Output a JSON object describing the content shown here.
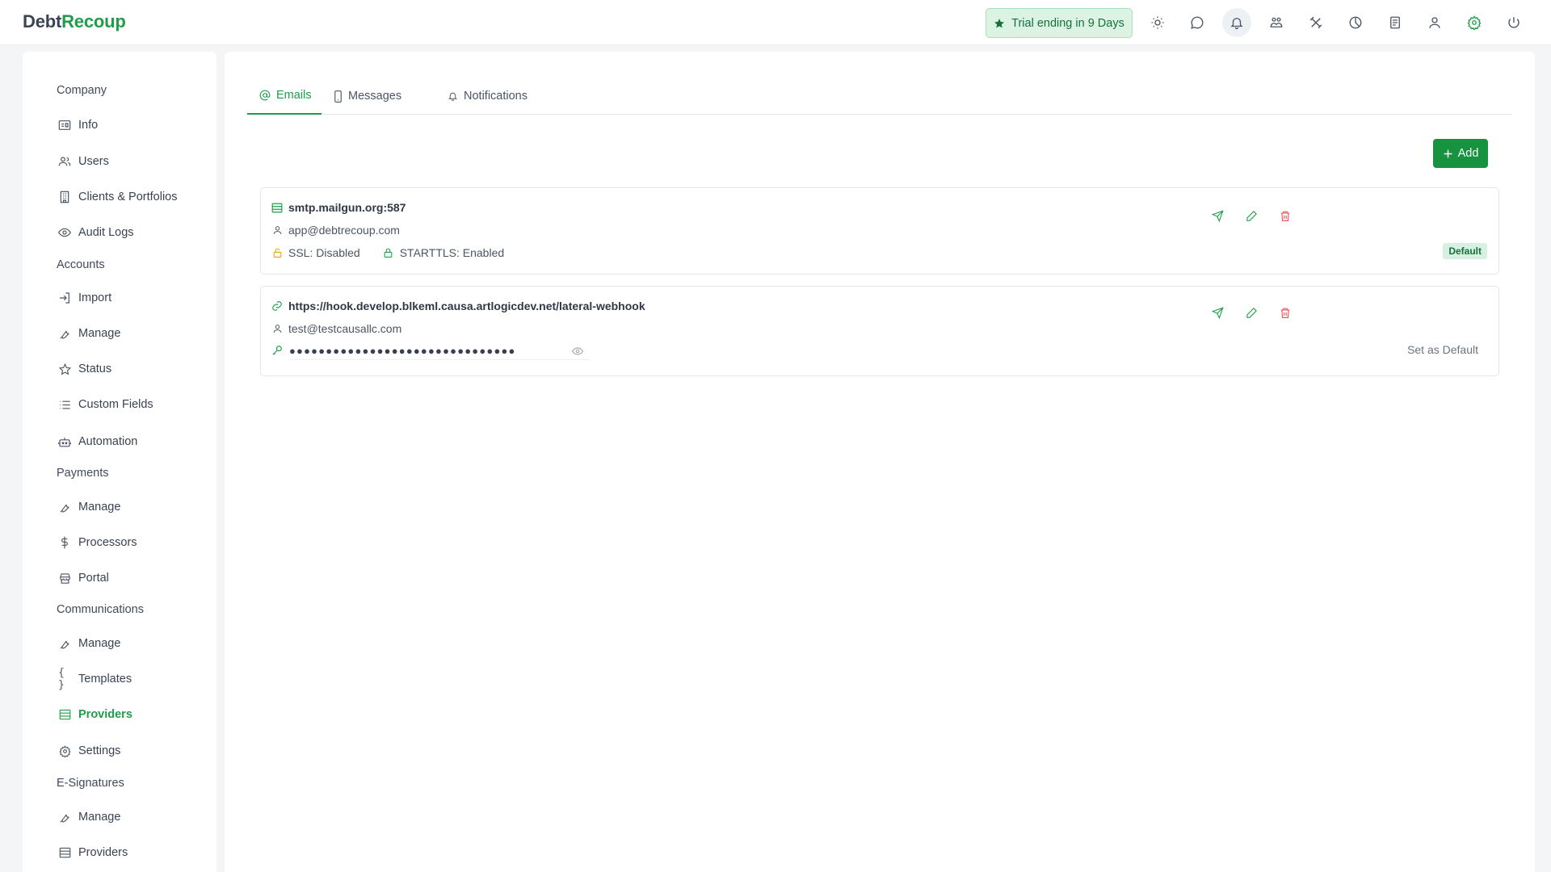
{
  "app": {
    "logo_part1": "Debt",
    "logo_part2": "Recoup"
  },
  "topbar": {
    "trial_label": "Trial ending in 9 Days",
    "icons": [
      "sun-icon",
      "chat-icon",
      "bell-icon",
      "handshake-icon",
      "tools-icon",
      "pie-chart-icon",
      "report-icon",
      "user-icon",
      "gear-icon",
      "power-icon"
    ]
  },
  "sidebar": {
    "sections": [
      {
        "title": "Company",
        "items": [
          "Info",
          "Users",
          "Clients & Portfolios",
          "Audit Logs"
        ]
      },
      {
        "title": "Accounts",
        "items": [
          "Import",
          "Manage",
          "Status",
          "Custom Fields",
          "Automation"
        ]
      },
      {
        "title": "Payments",
        "items": [
          "Manage",
          "Processors",
          "Portal"
        ]
      },
      {
        "title": "Communications",
        "items": [
          "Manage",
          "Templates",
          "Providers",
          "Settings"
        ]
      },
      {
        "title": "E-Signatures",
        "items": [
          "Manage",
          "Providers"
        ]
      }
    ],
    "active_item": "Providers"
  },
  "tabs": [
    {
      "label": "Emails",
      "active": true
    },
    {
      "label": "Messages",
      "active": false
    },
    {
      "label": "Notifications",
      "active": false
    }
  ],
  "add_button_label": "Add",
  "providers": [
    {
      "host": "smtp.mailgun.org:587",
      "user": "app@debtrecoup.com",
      "ssl": "SSL: Disabled",
      "starttls": "STARTTLS: Enabled",
      "status": "Default"
    },
    {
      "host": "https://hook.develop.blkeml.causa.artlogicdev.net/lateral-webhook",
      "user": "test@testcausallc.com",
      "password_mask": "●●●●●●●●●●●●●●●●●●●●●●●●●●●●●●●",
      "status": "Set as Default"
    }
  ],
  "colors": {
    "brand": "#1f9d4a",
    "danger": "#e5484d",
    "warning": "#e0a800"
  }
}
